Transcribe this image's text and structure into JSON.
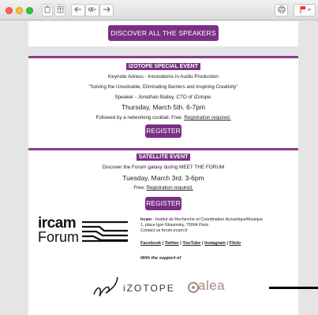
{
  "toolbar": {
    "window_title": "",
    "buttons": [
      "trash-icon",
      "archive-icon",
      "reply-icon",
      "reply-all-icon",
      "forward-icon",
      "print-icon",
      "flag-icon"
    ]
  },
  "top": {
    "discover_label": "DISCOVER ALL THE SPEAKERS"
  },
  "event1": {
    "tag": "IZOTOPE SPECIAL EVENT",
    "line1": "Keynote Adress - Innovations in Audio Production",
    "line2": "\"Solving the Unsolvable, Eliminating Barriers and Inspiring Creativity\"",
    "line3": "Speaker - Jonathan Bailey, CTO of iZotope.",
    "date": "Thursday, March 5th. 6-7pm",
    "note_prefix": "Followed by a networking cocktail. Free.",
    "note_link": "Registration required.",
    "register_label": "REGISTER"
  },
  "event2": {
    "tag": "SATELLITE EVENT",
    "line1": "Discover the Forum galaxy during MEET THE FORUM",
    "date": "Tuesday, March 3rd. 3-6pm",
    "note_prefix": "Free,",
    "note_link": "Registration required.",
    "register_label": "REGISTER"
  },
  "footer": {
    "logo_line1": "ircam",
    "logo_line2": "Forum",
    "org_name": "Ircam",
    "org_rest": " - Institut de Recherche et Coordination Acoustique/Musique",
    "address": "1, place Igor-Stravinsky, 75004 Paris",
    "contact": "Contact us forum.ircam.fr",
    "links": [
      "Facebook",
      "Twitter",
      "YouTube",
      "Instagram",
      "Flickr"
    ],
    "support": "With the support of",
    "sponsor1": "iZOTOPE",
    "sponsor2": "alea"
  },
  "colors": {
    "accent": "#7a2f84",
    "rule": "#8a3d8e"
  }
}
